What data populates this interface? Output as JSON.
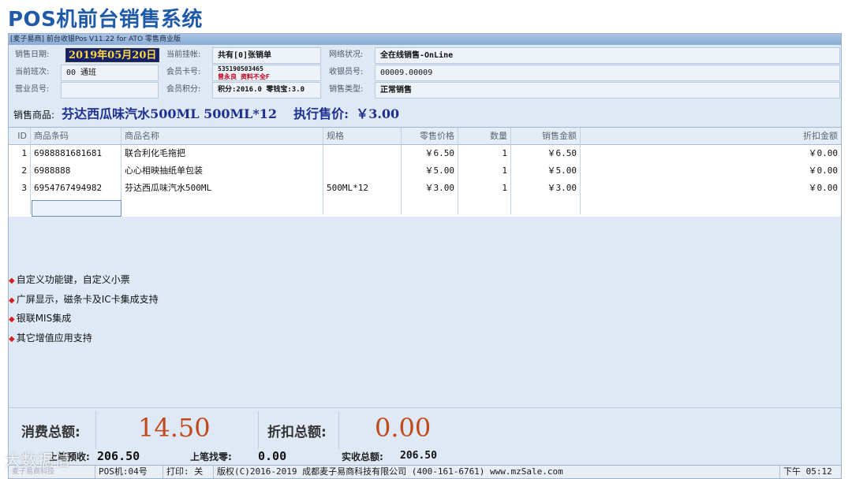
{
  "slide_title": "POS机前台销售系统",
  "window_title": "[麦子易商] 前台收银Pos V11.22 for ATO 零售商业版",
  "info": {
    "date_label": "销售日期:",
    "date_value": "2019年05月20日",
    "hang_label": "当前挂帐:",
    "hang_value": "共有[0]张销单",
    "network_label": "网络状况:",
    "network_value": "全在线销售-OnLine",
    "shift_label": "当前班次:",
    "shift_value": "00 通班",
    "card_label": "会员卡号:",
    "card_value": "535190503465",
    "member_name": "曾永良 资料不全F",
    "cashier_label": "收银员号:",
    "cashier_value": "00009.00009",
    "clerk_label": "营业员号:",
    "clerk_value": "",
    "points_label": "会员积分:",
    "points_value": "积分:2016.0 零钱宝:3.0",
    "saletype_label": "销售类型:",
    "saletype_value": "正常销售"
  },
  "sale": {
    "label": "销售商品:",
    "product": "芬达西瓜味汽水500ML 500ML*12",
    "price_label": "执行售价:",
    "price": "￥3.00"
  },
  "grid": {
    "headers": [
      "ID",
      "商品条码",
      "商品名称",
      "规格",
      "零售价格",
      "数量",
      "销售金额",
      "折扣金额"
    ],
    "rows": [
      {
        "id": "1",
        "code": "6988881681681",
        "name": "联合利化毛拖把",
        "spec": "",
        "price": "￥6.50",
        "qty": "1",
        "amount": "￥6.50",
        "discount": "￥0.00"
      },
      {
        "id": "2",
        "code": "6988888",
        "name": "心心相映抽纸单包装",
        "spec": "",
        "price": "￥5.00",
        "qty": "1",
        "amount": "￥5.00",
        "discount": "￥0.00"
      },
      {
        "id": "3",
        "code": "6954767494982",
        "name": "芬达西瓜味汽水500ML",
        "spec": "500ML*12",
        "price": "￥3.00",
        "qty": "1",
        "amount": "￥3.00",
        "discount": "￥0.00"
      }
    ]
  },
  "features": [
    "自定义功能键，自定义小票",
    "广屏显示，磁条卡及IC卡集成支持",
    "银联MIS集成",
    "其它增值应用支持"
  ],
  "totals": {
    "consume_label": "消费总额:",
    "consume_value": "14.50",
    "discount_label": "折扣总额:",
    "discount_value": "0.00"
  },
  "previous": {
    "prepaid_label": "上笔预收:",
    "prepaid_value": "206.50",
    "change_label": "上笔找零:",
    "change_value": "0.00",
    "received_label": "实收总额:",
    "received_value": "206.50"
  },
  "status": {
    "logo_text": "麦子易商科技",
    "pos": "POS机:04号",
    "print": "打印: 关",
    "copyright": "版权(C)2016-2019 成都麦子易商科技有限公司 (400-161-6761) www.mzSale.com",
    "time": "下午 05:12"
  },
  "watermark": "大数据信",
  "colors": {
    "title": "#1f5aa8",
    "panel": "#dfe9f5",
    "total_value": "#c04a1c",
    "date_bg": "#14206e",
    "date_fg": "#ffd93a",
    "bullet": "#d62020"
  }
}
